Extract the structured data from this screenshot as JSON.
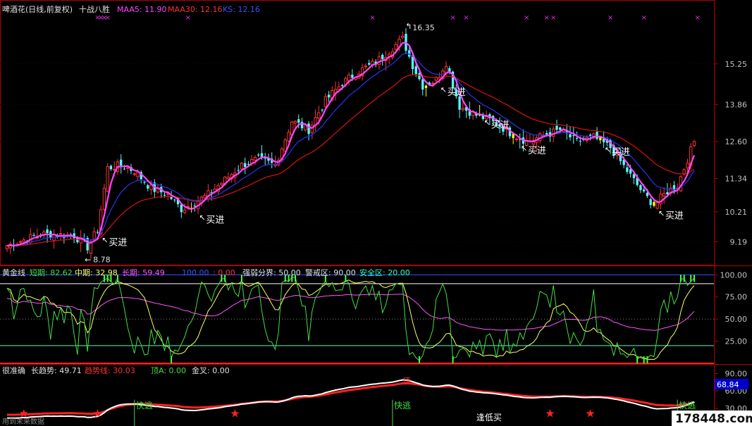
{
  "main_panel": {
    "stock": "啤酒花(日线,前复权)",
    "indicator": "十战八胜",
    "legend": [
      {
        "text": "MAA5: 11.90",
        "color": "#ff44ff"
      },
      {
        "text": "MAA30: 12.16",
        "color": "#ff3333"
      },
      {
        "text": "KS: 12.16",
        "color": "#3355ff"
      }
    ],
    "high_label": "16.35",
    "low_label": "8.78",
    "buy_label": "买进"
  },
  "gold_panel": {
    "legend": [
      {
        "text": "黄金线",
        "color": "#e0e0e0"
      },
      {
        "text": "短期: 82.62",
        "color": "#44dd44"
      },
      {
        "text": "中期: 32.98",
        "color": "#ffff66"
      },
      {
        "text": "长期: 59.49",
        "color": "#ff55ff"
      },
      {
        "text": "100.00",
        "color": "#3355ff"
      },
      {
        "text": ": 0.00",
        "color": "#ff3333"
      },
      {
        "text": "强弱分界: 50.00",
        "color": "#e0e0e0"
      },
      {
        "text": "警戒区: 90.00",
        "color": "#e0e0e0"
      },
      {
        "text": "安全区: 20.00",
        "color": "#33ffcc"
      }
    ],
    "ticks": [
      "100.00",
      "75.00",
      "50.00",
      "25.00"
    ]
  },
  "trend_panel": {
    "legend": [
      {
        "text": "很准确",
        "color": "#e0e0e0"
      },
      {
        "text": "长趋势: 49.71",
        "color": "#e0e0e0"
      },
      {
        "text": "趋势线: 30.03",
        "color": "#ff3333"
      },
      {
        "text": "顶A: 0.00",
        "color": "#44dd44"
      },
      {
        "text": "金叉: 0.00",
        "color": "#e0e0e0"
      }
    ],
    "ticks": [
      "90.00",
      "60.00",
      "30.00"
    ],
    "current_value": "68.84",
    "escape_label": "快逃",
    "top_label": "顶",
    "low_buy_label": "逢低买",
    "footer_text": "用到未来数据"
  },
  "watermark": "178448.com",
  "colors": {
    "up": "#ff3333",
    "down": "#54ffff",
    "highlight": "#ffff00",
    "ma5": "#ff44ff",
    "ma30": "#cc1111",
    "ks": "#2233dd"
  },
  "chart_data": [
    {
      "type": "candlestick",
      "title": "啤酒花(日线,前复权)",
      "yticks": [
        15.25,
        13.86,
        12.6,
        11.34,
        10.21,
        9.19
      ],
      "ylim": [
        8.5,
        16.9
      ],
      "anchor_points": [
        {
          "i": 0,
          "close": 9.05
        },
        {
          "i": 10,
          "close": 9.45
        },
        {
          "i": 20,
          "close": 9.4
        },
        {
          "i": 24,
          "close": 9.0
        },
        {
          "i": 27,
          "close": 9.6
        },
        {
          "i": 30,
          "close": 11.7
        },
        {
          "i": 34,
          "close": 11.8
        },
        {
          "i": 38,
          "close": 11.6
        },
        {
          "i": 43,
          "close": 11.0
        },
        {
          "i": 48,
          "close": 10.8
        },
        {
          "i": 52,
          "close": 10.3
        },
        {
          "i": 55,
          "close": 10.45
        },
        {
          "i": 60,
          "close": 10.8
        },
        {
          "i": 65,
          "close": 11.3
        },
        {
          "i": 70,
          "close": 11.8
        },
        {
          "i": 75,
          "close": 12.0
        },
        {
          "i": 80,
          "close": 11.8
        },
        {
          "i": 85,
          "close": 13.3
        },
        {
          "i": 90,
          "close": 13.0
        },
        {
          "i": 95,
          "close": 14.0
        },
        {
          "i": 100,
          "close": 14.6
        },
        {
          "i": 105,
          "close": 15.0
        },
        {
          "i": 110,
          "close": 15.3
        },
        {
          "i": 115,
          "close": 15.8
        },
        {
          "i": 118,
          "close": 16.1
        },
        {
          "i": 121,
          "close": 15.2
        },
        {
          "i": 124,
          "close": 14.5
        },
        {
          "i": 128,
          "close": 14.7
        },
        {
          "i": 131,
          "close": 15.3
        },
        {
          "i": 135,
          "close": 13.8
        },
        {
          "i": 140,
          "close": 13.5
        },
        {
          "i": 145,
          "close": 13.3
        },
        {
          "i": 150,
          "close": 12.9
        },
        {
          "i": 155,
          "close": 12.6
        },
        {
          "i": 160,
          "close": 12.8
        },
        {
          "i": 165,
          "close": 13.0
        },
        {
          "i": 170,
          "close": 12.6
        },
        {
          "i": 175,
          "close": 12.75
        },
        {
          "i": 180,
          "close": 12.4
        },
        {
          "i": 185,
          "close": 11.6
        },
        {
          "i": 190,
          "close": 10.8
        },
        {
          "i": 193,
          "close": 10.45
        },
        {
          "i": 197,
          "close": 10.9
        },
        {
          "i": 200,
          "close": 11.1
        },
        {
          "i": 203,
          "close": 12.0
        },
        {
          "i": 205,
          "close": 12.6
        }
      ],
      "highlight_bars": [
        55,
        125,
        141,
        151,
        177,
        193
      ],
      "buy_signal_bars": [
        27,
        56,
        128,
        141,
        152,
        177,
        193
      ],
      "high": {
        "i": 118,
        "value": 16.35
      },
      "low": {
        "i": 24,
        "value": 8.78
      },
      "x_markers_bars": [
        27,
        28,
        29,
        30,
        54,
        109,
        133,
        137,
        155,
        161,
        163,
        180,
        190,
        206
      ]
    },
    {
      "type": "line",
      "title": "黄金线",
      "series": [
        {
          "name": "短期",
          "last": 82.62
        },
        {
          "name": "中期",
          "last": 32.98
        },
        {
          "name": "长期",
          "last": 59.49
        }
      ],
      "reference_lines": [
        100,
        90,
        50,
        20,
        0
      ],
      "ylim": [
        0,
        105
      ]
    },
    {
      "type": "line",
      "title": "很准确",
      "series": [
        {
          "name": "长趋势",
          "last": 49.71
        },
        {
          "name": "趋势线",
          "last": 30.03
        }
      ],
      "ylim": [
        0,
        100
      ],
      "star_bars": [
        5,
        27,
        68,
        162,
        174
      ],
      "escape_bars": [
        38,
        115,
        200
      ]
    }
  ]
}
